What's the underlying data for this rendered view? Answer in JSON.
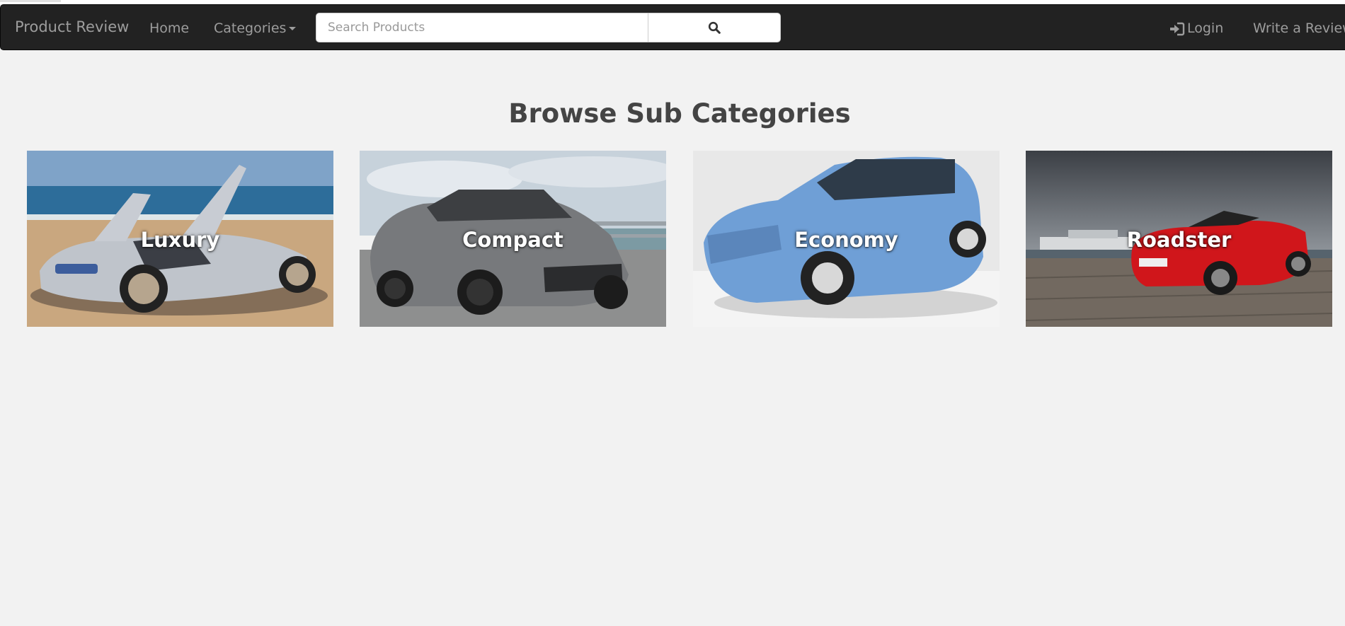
{
  "navbar": {
    "brand": "Product Review",
    "home": "Home",
    "categories": "Categories",
    "search": {
      "placeholder": "Search Products",
      "value": ""
    },
    "login": "Login",
    "write_review": "Write a Review"
  },
  "main": {
    "title": "Browse Sub Categories",
    "subcategories": [
      {
        "label": "Luxury"
      },
      {
        "label": "Compact"
      },
      {
        "label": "Economy"
      },
      {
        "label": "Roadster"
      }
    ]
  },
  "colors": {
    "navbar_bg": "#222222",
    "nav_text": "#9d9d9d",
    "page_bg": "#f2f2f2",
    "title_text": "#444444"
  },
  "icons": [
    "search-icon",
    "login-icon",
    "caret-down-icon"
  ]
}
